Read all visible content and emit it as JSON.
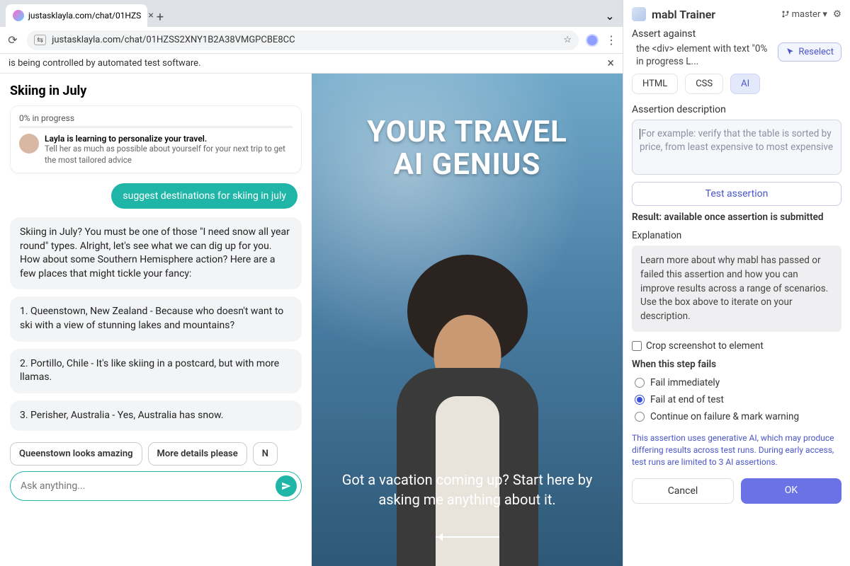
{
  "browser": {
    "tab_title": "justasklayla.com/chat/01HZS",
    "url": "justasklayla.com/chat/01HZSS2XNY1B2A38VMGPCBE8CC",
    "automation_banner": "is being controlled by automated test software."
  },
  "chat": {
    "title": "Skiing in July",
    "progress_label": "0% in progress",
    "learning_title": "Layla is learning to personalize your travel.",
    "learning_sub": "Tell her as much as possible about yourself for your next trip to get the most tailored advice",
    "user_chip": "suggest destinations for skiing in july",
    "bubbles": [
      "Skiing in July? You must be one of those \"I need snow all year round\" types. Alright, let's see what we can dig up for you. How about some Southern Hemisphere action? Here are a few places that might tickle your fancy:",
      "1. Queenstown, New Zealand - Because who doesn't want to ski with a view of stunning lakes and mountains?",
      "2. Portillo, Chile - It's like skiing in a postcard, but with more llamas.",
      "3. Perisher, Australia - Yes, Australia has snow."
    ],
    "suggestions": [
      "Queenstown looks amazing",
      "More details please",
      "N"
    ],
    "ask_placeholder": "Ask anything..."
  },
  "hero": {
    "line1": "YOUR TRAVEL",
    "line2": "AI GENIUS",
    "sub": "Got a vacation coming up? Start here by asking me anything about it."
  },
  "trainer": {
    "brand": "mabl Trainer",
    "branch": "master",
    "assert_label": "Assert against",
    "assert_target": "the <div> element with text \"0% in progress L...",
    "reselect": "Reselect",
    "tabs": {
      "html": "HTML",
      "css": "CSS",
      "ai": "AI"
    },
    "desc_label": "Assertion description",
    "desc_placeholder": "For example: verify that the table is sorted by price, from least expensive to most expensive",
    "test_btn": "Test assertion",
    "result": "Result: available once assertion is submitted",
    "explanation_label": "Explanation",
    "explanation_text": "Learn more about why mabl has passed or failed this assertion and how you can improve results across a range of scenarios. Use the box above to iterate on your description.",
    "crop_label": "Crop screenshot to element",
    "when_fails": "When this step fails",
    "fail_opts": [
      "Fail immediately",
      "Fail at end of test",
      "Continue on failure & mark warning"
    ],
    "fail_selected": 1,
    "footnote": "This assertion uses generative AI, which may produce differing results across test runs. During early access, test runs are limited to 3 AI assertions.",
    "cancel": "Cancel",
    "ok": "OK"
  }
}
